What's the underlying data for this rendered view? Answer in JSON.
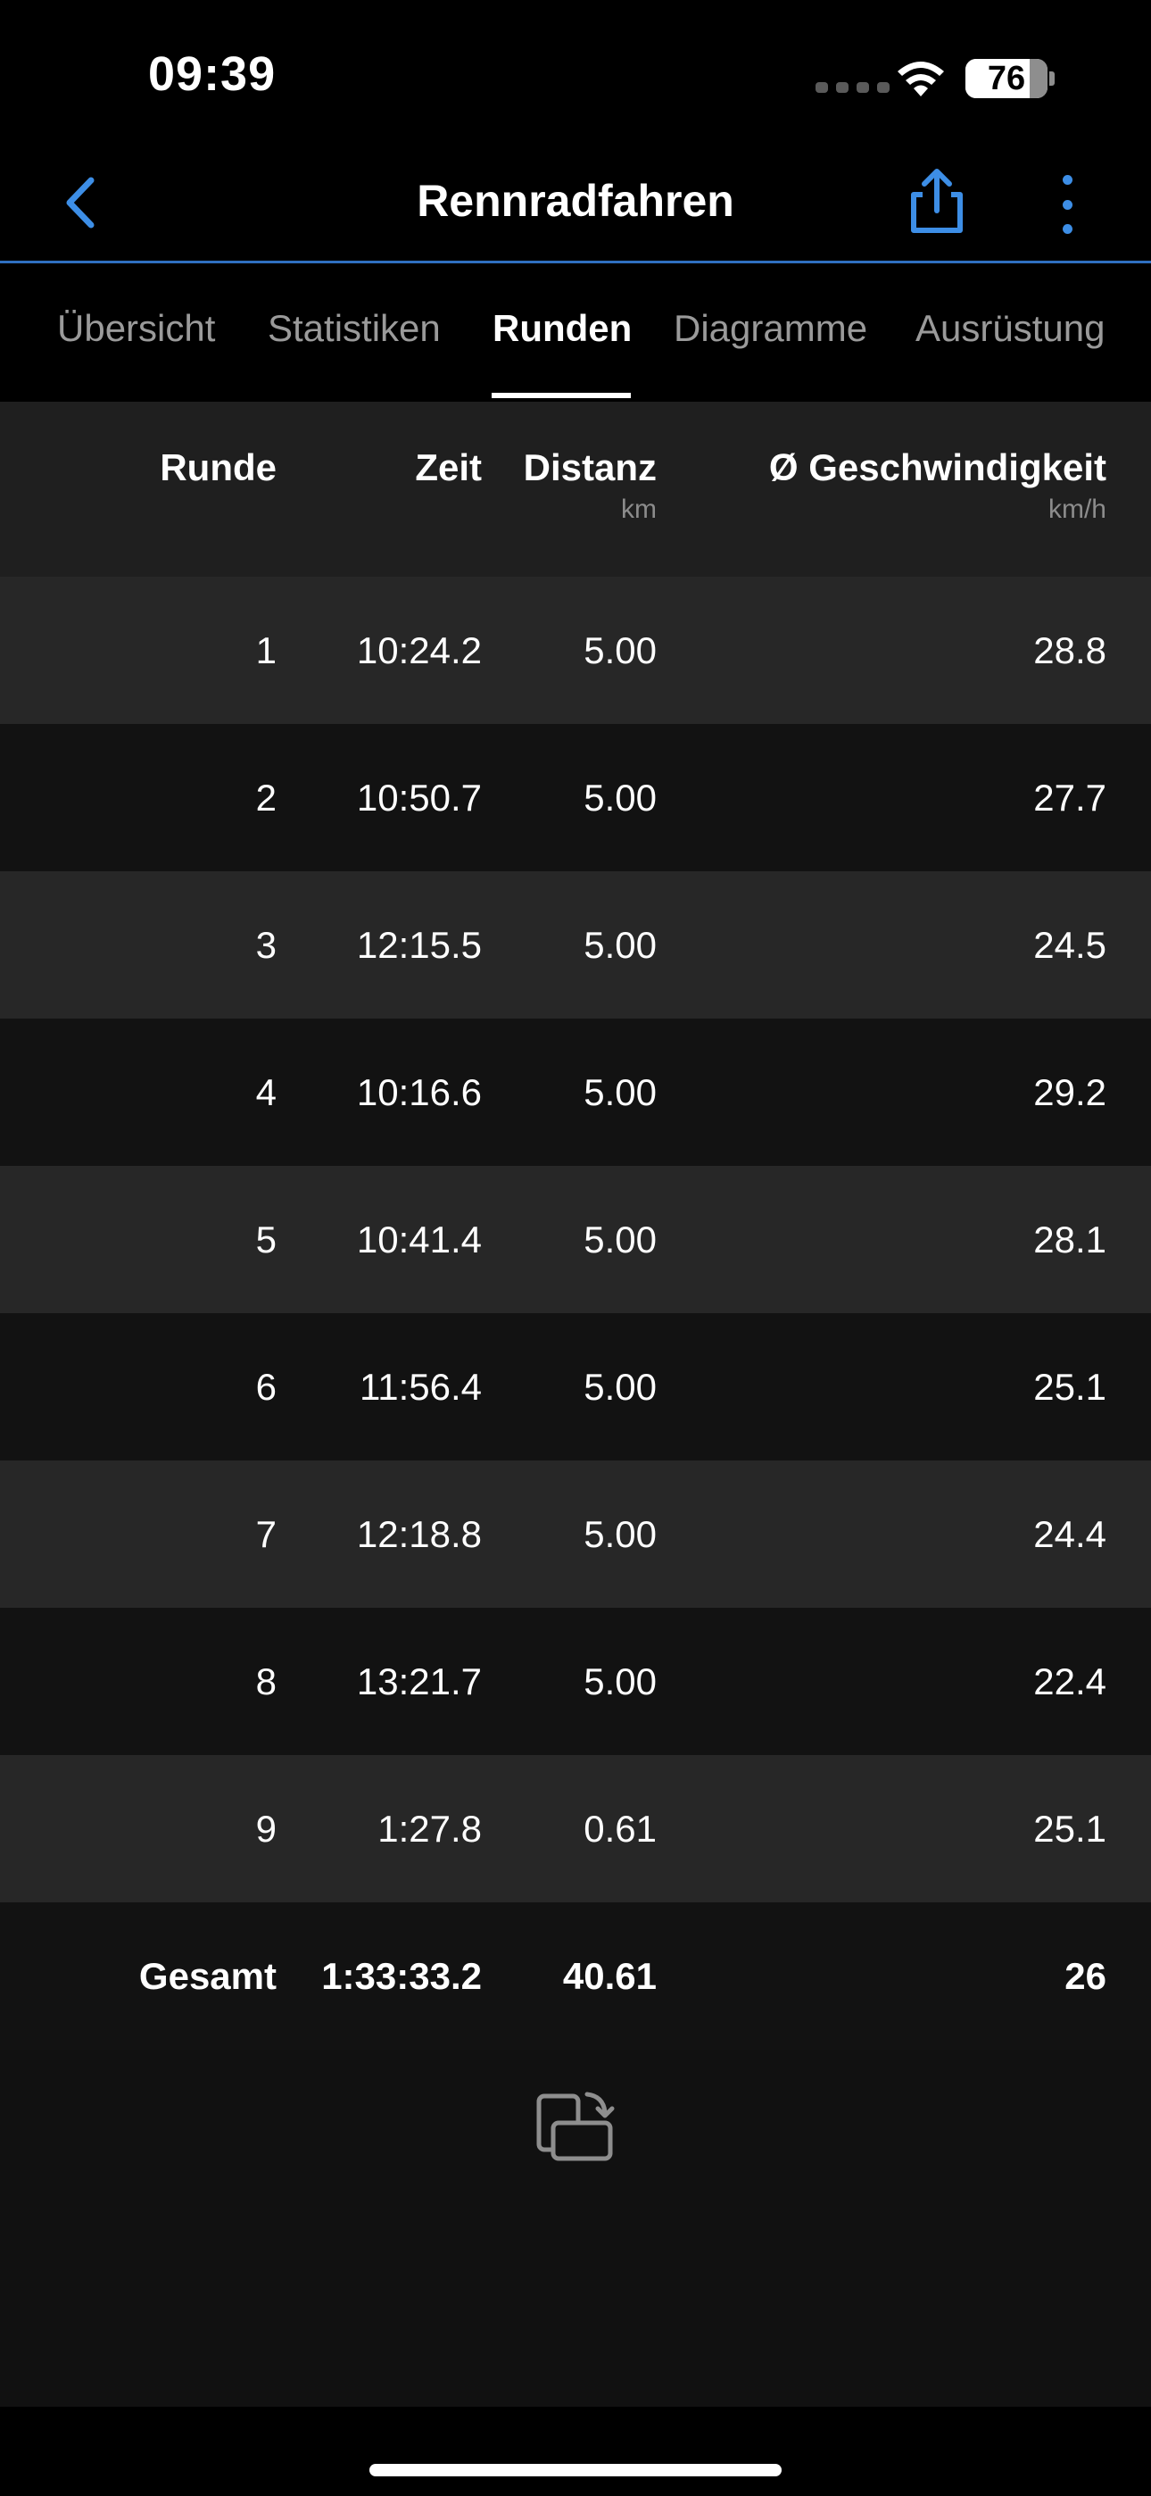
{
  "status_bar": {
    "time": "09:39",
    "battery": "76"
  },
  "nav": {
    "title": "Rennradfahren",
    "accent_color": "#3d8ee6",
    "back_icon": "chevron-left-icon",
    "share_icon": "share-icon",
    "more_icon": "vertical-ellipsis-icon"
  },
  "tabs": [
    {
      "label": "Übersicht",
      "active": false
    },
    {
      "label": "Statistiken",
      "active": false
    },
    {
      "label": "Runden",
      "active": true
    },
    {
      "label": "Diagramme",
      "active": false
    },
    {
      "label": "Ausrüstung",
      "active": false
    }
  ],
  "table": {
    "headers": {
      "lap": "Runde",
      "time": "Zeit",
      "distance": "Distanz",
      "distance_unit": "km",
      "speed": "Ø Geschwindigkeit",
      "speed_unit": "km/h"
    },
    "rows": [
      {
        "lap": "1",
        "time": "10:24.2",
        "distance": "5.00",
        "speed": "28.8"
      },
      {
        "lap": "2",
        "time": "10:50.7",
        "distance": "5.00",
        "speed": "27.7"
      },
      {
        "lap": "3",
        "time": "12:15.5",
        "distance": "5.00",
        "speed": "24.5"
      },
      {
        "lap": "4",
        "time": "10:16.6",
        "distance": "5.00",
        "speed": "29.2"
      },
      {
        "lap": "5",
        "time": "10:41.4",
        "distance": "5.00",
        "speed": "28.1"
      },
      {
        "lap": "6",
        "time": "11:56.4",
        "distance": "5.00",
        "speed": "25.1"
      },
      {
        "lap": "7",
        "time": "12:18.8",
        "distance": "5.00",
        "speed": "24.4"
      },
      {
        "lap": "8",
        "time": "13:21.7",
        "distance": "5.00",
        "speed": "22.4"
      },
      {
        "lap": "9",
        "time": "1:27.8",
        "distance": "0.61",
        "speed": "25.1"
      }
    ],
    "total": {
      "lap": "Gesamt",
      "time": "1:33:33.2",
      "distance": "40.61",
      "speed": "26"
    }
  },
  "rotate_icon": "rotate-screen-icon"
}
